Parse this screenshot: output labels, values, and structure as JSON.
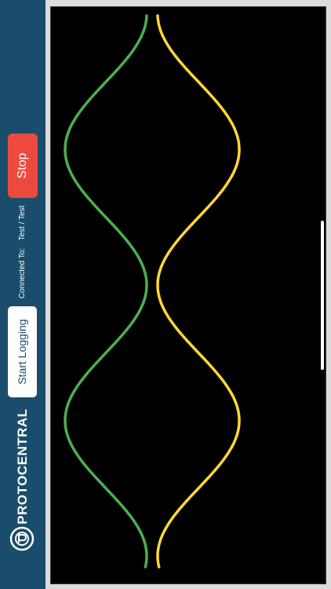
{
  "sidebar": {
    "stop_label": "Stop",
    "connected_label": "Connected To:",
    "connected_value": "Test / Test",
    "start_logging_label": "Start Logging",
    "brand_text": "PROTOCENTRAL",
    "logo_icon": "protocentral-logo-icon",
    "bg_color": "#1a4d6b",
    "stop_color": "#ec4a3f"
  },
  "plot": {
    "background": "#000000",
    "series": [
      {
        "color": "#4caf50"
      },
      {
        "color": "#fdd835"
      }
    ]
  }
}
